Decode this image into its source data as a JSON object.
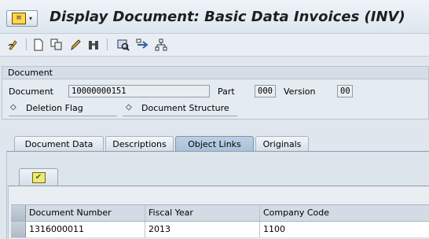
{
  "window": {
    "title": "Display Document: Basic Data Invoices (INV)"
  },
  "toolbar": {
    "icons": [
      "other-document-icon",
      "new-document-icon",
      "copy-icon",
      "change-icon",
      "binoculars-icon",
      "display-original-icon",
      "navigate-icon",
      "structure-icon"
    ]
  },
  "document_group": {
    "title": "Document",
    "document_label": "Document",
    "document_value": "10000000151",
    "part_label": "Part",
    "part_value": "000",
    "version_label": "Version",
    "version_value": "00",
    "deletion_flag_label": "Deletion Flag",
    "document_structure_label": "Document Structure"
  },
  "tabs": [
    {
      "label": "Document Data",
      "active": false
    },
    {
      "label": "Descriptions",
      "active": false
    },
    {
      "label": "Object Links",
      "active": true
    },
    {
      "label": "Originals",
      "active": false
    }
  ],
  "object_links": {
    "columns": [
      "Document Number",
      "Fiscal Year",
      "Company Code"
    ],
    "rows": [
      [
        "1316000011",
        "2013",
        "1100"
      ]
    ]
  }
}
